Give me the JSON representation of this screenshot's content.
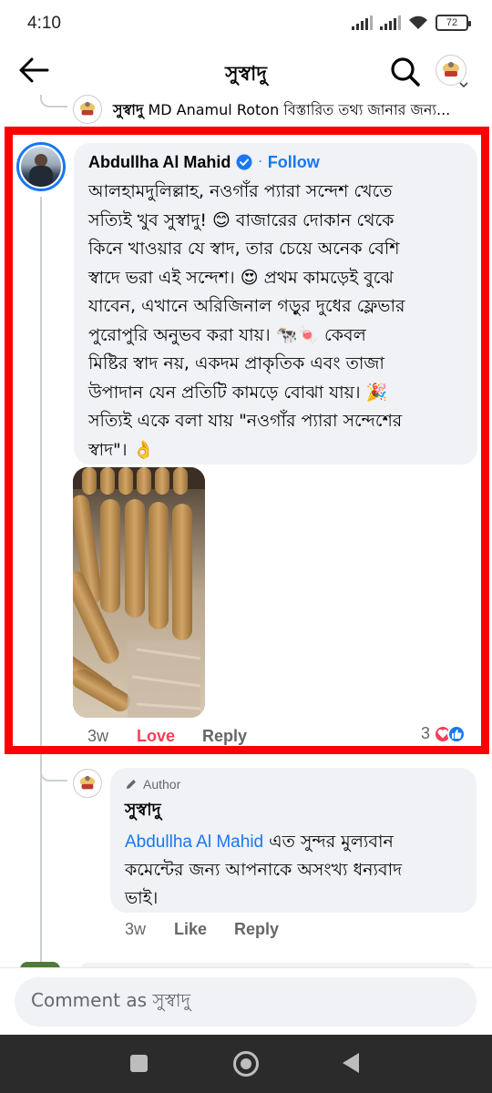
{
  "status_bar": {
    "time": "4:10",
    "battery": "72"
  },
  "header": {
    "title": "সুস্বাদু"
  },
  "previous_reply": {
    "name": "সুস্বাদু",
    "text": "MD Anamul Roton বিস্তারিত তথ্য জানার জন্য..."
  },
  "comment": {
    "author": "Abdullha Al Mahid",
    "separator": "·",
    "follow_label": "Follow",
    "lines": [
      "আলহামদুলিল্লাহ, নওগাঁর প্যারা সন্দেশ খেতে",
      "সত্যিই খুব সুস্বাদু! 😊 বাজারের দোকান থেকে",
      "কিনে খাওয়ার যে স্বাদ, তার চেয়ে অনেক বেশি",
      "স্বাদে ভরা এই সন্দেশ। 😍 প্রথম কামড়েই বুঝে",
      "যাবেন, এখানে অরিজিনাল গড়ুর দুধের ফ্লেভার",
      "পুরোপুরি অনুভব করা যায়। 🐄🍬 কেবল",
      "মিষ্টির স্বাদ নয়, একদম প্রাকৃতিক এবং তাজা",
      "উপাদান যেন প্রতিটি কামড়ে বোঝা যায়। 🎉",
      "সত্যিই একে বলা যায় \"নওগাঁর প্যারা সন্দেশের",
      "স্বাদ\"। 👌"
    ],
    "time": "3w",
    "reaction_label": "Love",
    "reply_label": "Reply",
    "reaction_count": "3",
    "reaction_types": [
      "heart-react",
      "like-react"
    ]
  },
  "author_reply": {
    "badge": "Author",
    "name": "সুস্বাদু",
    "mention": "Abdullha Al Mahid",
    "text_after_mention": " এত সুন্দর মুল্যবান",
    "lines": [
      "কমেন্টের জন্য আপনাকে অসংখ্য ধন্যবাদ",
      "ভাই।"
    ],
    "time": "3w",
    "like_label": "Like",
    "reply_label": "Reply"
  },
  "composer": {
    "placeholder": "Comment as সুস্বাদু"
  },
  "colors": {
    "accent": "#1877f2",
    "love": "#f33e58",
    "highlight": "#ff0000",
    "bubble": "#f0f2f5"
  }
}
